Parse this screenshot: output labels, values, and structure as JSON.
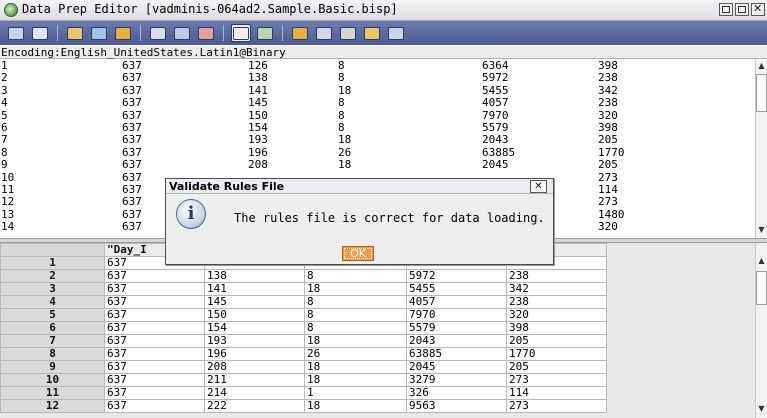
{
  "window": {
    "title": "Data Prep Editor [vadminis-064ad2.Sample.Basic.bisp]"
  },
  "toolbar": {
    "buttons": [
      "open-icon",
      "associate-icon",
      "field-props-icon",
      "data-load-props-icon",
      "dimension-build-icon",
      "move-field-icon",
      "join-fields-icon",
      "split-field-icon",
      "data-load-fields-icon",
      "dim-build-fields-icon",
      "create-field-icon",
      "select-records-icon",
      "reject-records-icon",
      "sort-icon",
      "validate-icon"
    ],
    "active_index": 8,
    "colors": {
      "bar": "#5b6aa0",
      "accent": "#e6b040"
    }
  },
  "encoding": "Encoding:English_UnitedStates.Latin1@Binary",
  "upper_rows": [
    [
      "1",
      "637",
      "126",
      "8",
      "6364",
      "398"
    ],
    [
      "2",
      "637",
      "138",
      "8",
      "5972",
      "238"
    ],
    [
      "3",
      "637",
      "141",
      "18",
      "5455",
      "342"
    ],
    [
      "4",
      "637",
      "145",
      "8",
      "4057",
      "238"
    ],
    [
      "5",
      "637",
      "150",
      "8",
      "7970",
      "320"
    ],
    [
      "6",
      "637",
      "154",
      "8",
      "5579",
      "398"
    ],
    [
      "7",
      "637",
      "193",
      "18",
      "2043",
      "205"
    ],
    [
      "8",
      "637",
      "196",
      "26",
      "63885",
      "1770"
    ],
    [
      "9",
      "637",
      "208",
      "18",
      "2045",
      "205"
    ],
    [
      "10",
      "637",
      "",
      "",
      "",
      "273"
    ],
    [
      "11",
      "637",
      "",
      "",
      "",
      "114"
    ],
    [
      "12",
      "637",
      "",
      "",
      "",
      "273"
    ],
    [
      "13",
      "637",
      "",
      "",
      "",
      "1480"
    ],
    [
      "14",
      "637",
      "",
      "",
      "",
      "320"
    ]
  ],
  "grid": {
    "headers": [
      "\"Day_I",
      "",
      "",
      "",
      "ata*"
    ],
    "rows": [
      [
        "1",
        "637",
        "",
        "",
        "",
        ""
      ],
      [
        "2",
        "637",
        "138",
        "8",
        "5972",
        "238"
      ],
      [
        "3",
        "637",
        "141",
        "18",
        "5455",
        "342"
      ],
      [
        "4",
        "637",
        "145",
        "8",
        "4057",
        "238"
      ],
      [
        "5",
        "637",
        "150",
        "8",
        "7970",
        "320"
      ],
      [
        "6",
        "637",
        "154",
        "8",
        "5579",
        "398"
      ],
      [
        "7",
        "637",
        "193",
        "18",
        "2043",
        "205"
      ],
      [
        "8",
        "637",
        "196",
        "26",
        "63885",
        "1770"
      ],
      [
        "9",
        "637",
        "208",
        "18",
        "2045",
        "205"
      ],
      [
        "10",
        "637",
        "211",
        "18",
        "3279",
        "273"
      ],
      [
        "11",
        "637",
        "214",
        "1",
        "326",
        "114"
      ],
      [
        "12",
        "637",
        "222",
        "18",
        "9563",
        "273"
      ]
    ]
  },
  "dialog": {
    "title": "Validate Rules File",
    "message": "The rules file is correct for data loading.",
    "ok_label": "OK",
    "close_label": "✕"
  }
}
